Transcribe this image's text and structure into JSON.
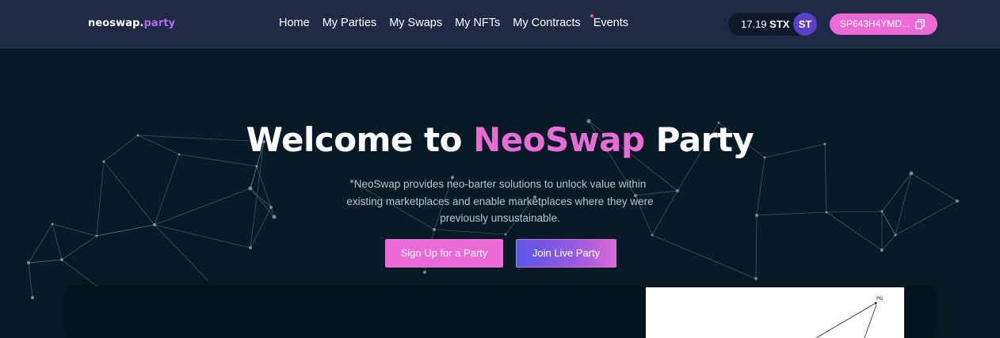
{
  "brand": {
    "name": "neoswap.",
    "suffix": "party"
  },
  "nav": {
    "items": [
      {
        "label": "Home"
      },
      {
        "label": "My Parties"
      },
      {
        "label": "My Swaps"
      },
      {
        "label": "My NFTs"
      },
      {
        "label": "My Contracts"
      },
      {
        "label": "Events"
      }
    ]
  },
  "account": {
    "balance": "17.19",
    "currency": "STX",
    "avatar_initials": "ST",
    "wallet_address": "SP643H4YMD..."
  },
  "hero": {
    "title_prefix": "Welcome to ",
    "title_brand": "NeoSwap",
    "title_suffix": " Party",
    "subtitle": "NeoSwap provides neo-barter solutions to unlock value within existing marketplaces and enable marketplaces where they were previously unsustainable.",
    "primary_button": "Sign Up for a Party",
    "secondary_button": "Join Live Party"
  },
  "preview": {
    "node_label": "PG"
  },
  "colors": {
    "nav_bg": "#1f2a46",
    "page_bg": "#071b26",
    "accent_pink": "#ea6ad8",
    "accent_purple": "#b56bf0",
    "avatar_bg": "#5a3fc7"
  }
}
